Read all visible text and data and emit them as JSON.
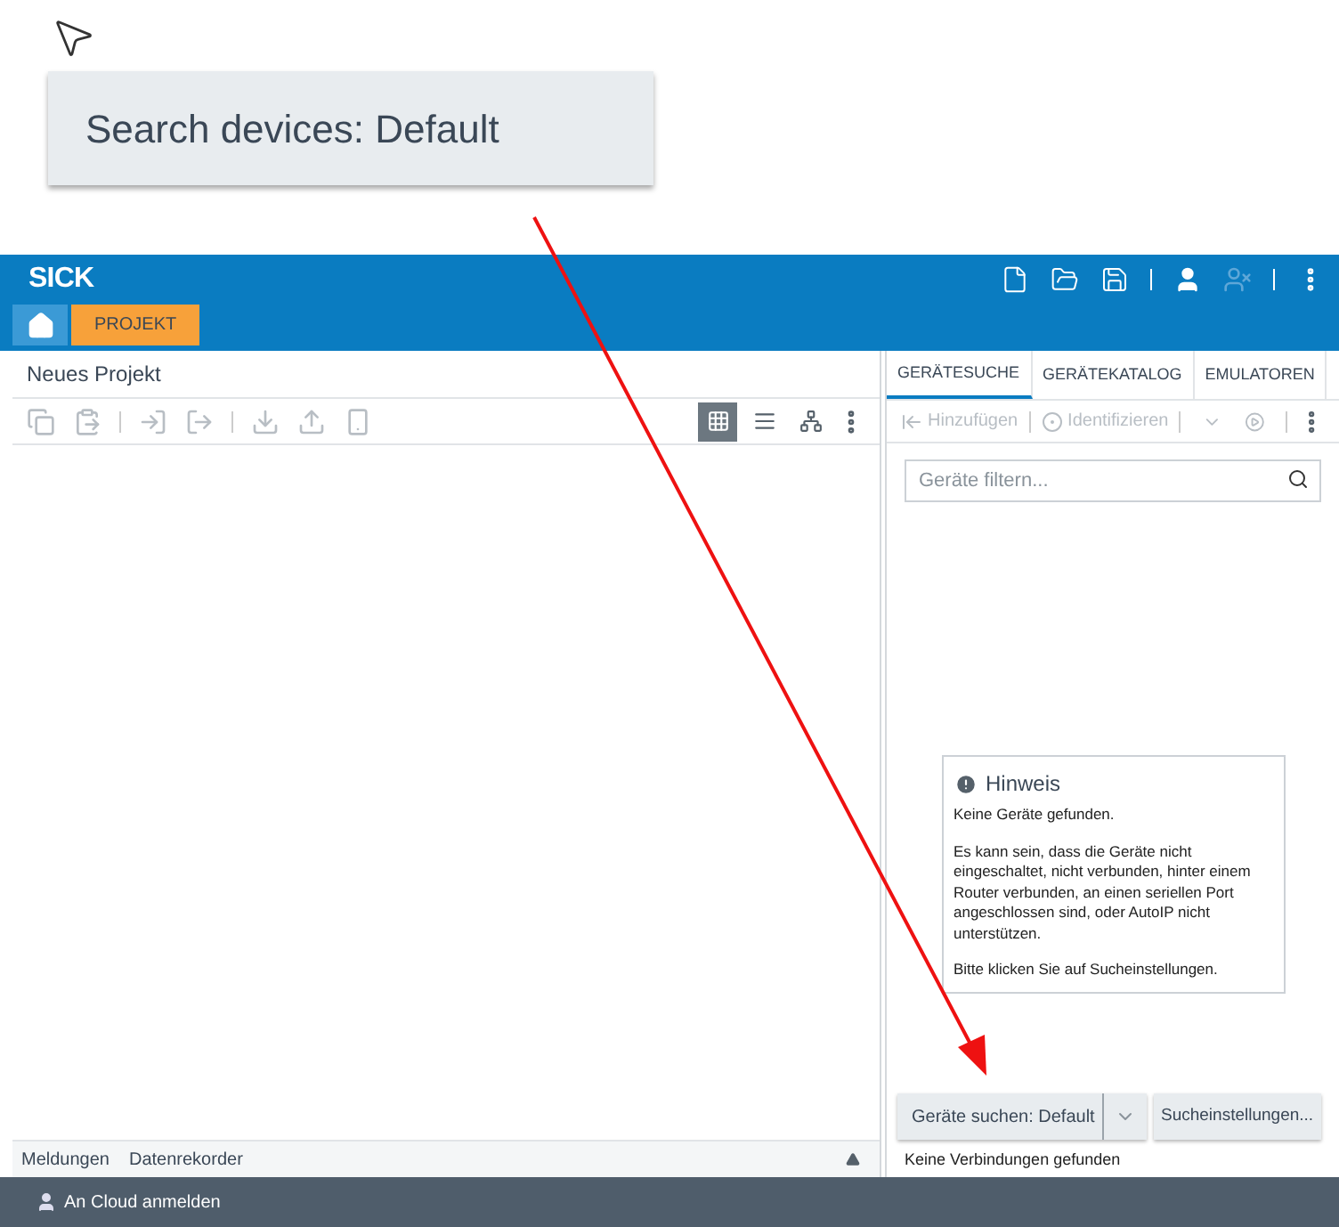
{
  "callout": {
    "text": "Search devices: Default"
  },
  "app": {
    "logo": "SICK",
    "tabs": [
      {
        "label": "PROJEKT",
        "selected": true
      }
    ],
    "project": {
      "title": "Neues Projekt",
      "views": [
        {
          "kind": "grid",
          "selected": true
        },
        {
          "kind": "list",
          "selected": false
        },
        {
          "kind": "tree",
          "selected": false
        }
      ]
    },
    "bottom_tabs": [
      "Meldungen",
      "Datenrekorder"
    ],
    "right_tabs": [
      {
        "label": "GERÄTESUCHE",
        "selected": true
      },
      {
        "label": "GERÄTEKATALOG",
        "selected": false
      },
      {
        "label": "EMULATOREN",
        "selected": false
      }
    ],
    "right_toolbar": [
      {
        "label": "Hinzufügen",
        "disabled": true
      },
      {
        "label": "Identifizieren",
        "disabled": true
      }
    ],
    "filter": {
      "placeholder": "Geräte filtern..."
    },
    "notice": {
      "title": "Hinweis",
      "paragraphs": [
        "Keine Geräte gefunden.",
        "Es kann sein, dass die Geräte nicht eingeschaltet, nicht verbunden, hinter einem Router verbunden, an einen seriellen Port angeschlossen sind, oder AutoIP nicht unterstützen.",
        "Bitte klicken Sie auf Sucheinstellungen."
      ]
    },
    "search_button": "Geräte suchen: Default",
    "settings_button": "Sucheinstellungen...",
    "connection_status": "Keine Verbindungen gefunden",
    "footer": "An Cloud anmelden"
  }
}
